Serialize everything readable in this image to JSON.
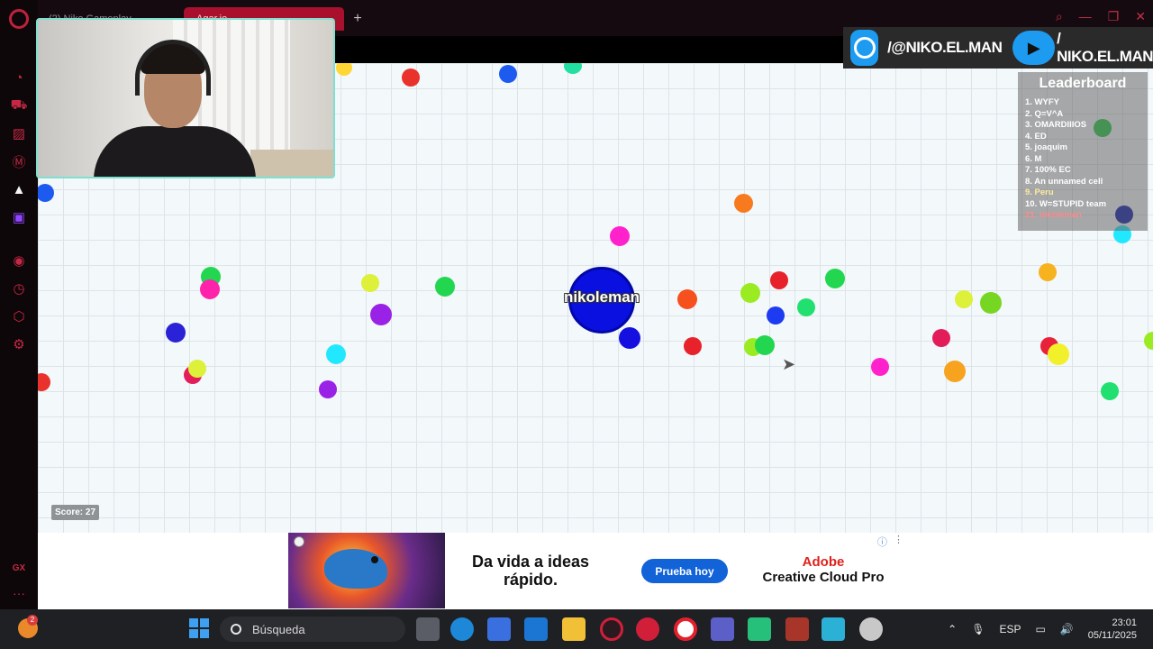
{
  "browser": {
    "tabs": [
      {
        "label": "(2) Niko Gameplay",
        "active": false
      },
      {
        "label": "Agar.io",
        "active": true
      }
    ],
    "new_tab_symbol": "+",
    "sidebar_icons": [
      "opera-gx-logo",
      "speed-dial-icon",
      "flow-icon",
      "wallet-icon",
      "messenger-icon",
      "bookmarks-icon",
      "twitch-icon",
      "player-icon",
      "history-icon",
      "extensions-icon",
      "settings-icon"
    ],
    "gx_label": "GX",
    "more_symbol": "···"
  },
  "game": {
    "player_name": "nikoleman",
    "score_label": "Score: 27",
    "player_color": "#0a10e0",
    "leaderboard_title": "Leaderboard",
    "leaderboard": [
      "1. WYFY",
      "2. Q=V^A",
      "3. OMARDIIIOS",
      "4. ED",
      "5. joaquim",
      "6. M",
      "7. 100% EC",
      "8. An unnamed cell",
      "9. Peru",
      "10. W=STUPID team",
      "21. nikoleman"
    ],
    "pellet_colors": [
      "#e8322b",
      "#1d5bf0",
      "#22e0a0",
      "#ffd633",
      "#ff22cc",
      "#9a22e6",
      "#22d650",
      "#f77a1f",
      "#22e8ff",
      "#ddf03a",
      "#e31d5a"
    ]
  },
  "social": {
    "instagram_handle": "/@NIKO.EL.MAN",
    "youtube_handle": "/ NIKO.EL.MAN",
    "accent": "#1d9bf0"
  },
  "ad": {
    "headline": "Da vida a ideas rápido.",
    "cta": "Prueba hoy",
    "brand_line1": "Adobe",
    "brand_line2": "Creative Cloud Pro",
    "info_icon": "ⓘ",
    "close_symbol": "✕"
  },
  "taskbar": {
    "weather_badge": "2",
    "search_placeholder": "Búsqueda",
    "language": "ESP",
    "time": "23:01",
    "date": "05/11/2025"
  }
}
